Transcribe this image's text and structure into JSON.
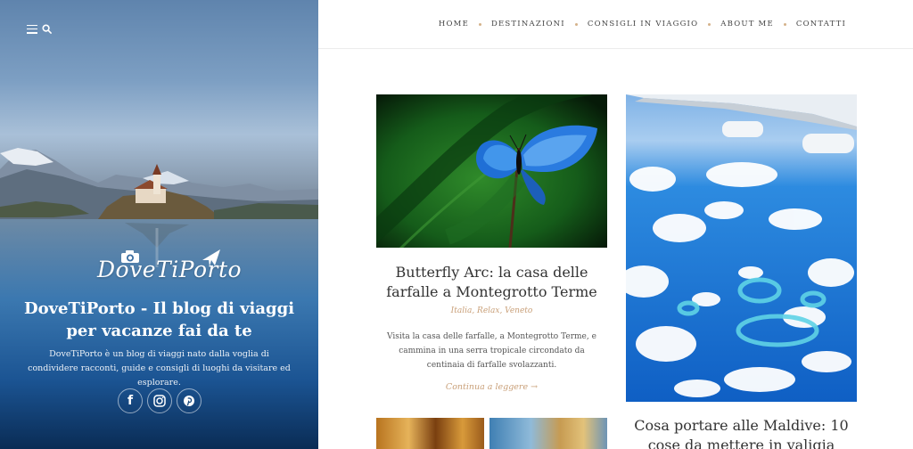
{
  "brand": {
    "logo_text": "DoveTiPorto",
    "site_title": "DoveTiPorto - Il blog di viaggi per vacanze fai da te",
    "description": "DoveTiPorto è un blog di viaggi nato dalla voglia di condividere racconti, guide e consigli di luoghi da visitare ed esplorare."
  },
  "header_icons": [
    "menu-icon",
    "search-icon"
  ],
  "socials": [
    {
      "name": "facebook-icon",
      "glyph": "f"
    },
    {
      "name": "instagram-icon",
      "glyph": ""
    },
    {
      "name": "pinterest-icon",
      "glyph": ""
    }
  ],
  "nav": {
    "items": [
      "HOME",
      "DESTINAZIONI",
      "CONSIGLI IN VIAGGIO",
      "ABOUT ME",
      "CONTATTI"
    ]
  },
  "posts": [
    {
      "title": "Butterfly Arc: la casa delle farfalle a Montegrotto Terme",
      "categories": "Italia, Relax, Veneto",
      "excerpt": "Visita la casa delle farfalle, a Montegrotto Terme, e cammina in una serra tropicale circondato da centinaia di farfalle svolazzanti.",
      "read_more": "Continua a leggere →"
    },
    {
      "title": "Cosa portare alle Maldive: 10 cose da mettere in valigia"
    }
  ],
  "colors": {
    "accent": "#c9a079",
    "nav_text": "#444444",
    "title_text": "#333333"
  }
}
